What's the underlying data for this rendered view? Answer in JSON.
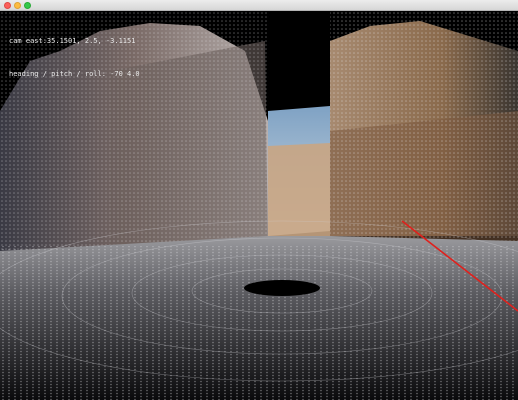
{
  "window": {
    "title": ""
  },
  "hud": {
    "camera_line": "cam east:35.1501, 2.5, -3.1151",
    "orientation_line": "heading / pitch / roll: -70 4.0"
  },
  "scene": {
    "description": "3D point cloud street view with buildings",
    "marker_color": "#e0201c",
    "sky_color": "#000000"
  }
}
